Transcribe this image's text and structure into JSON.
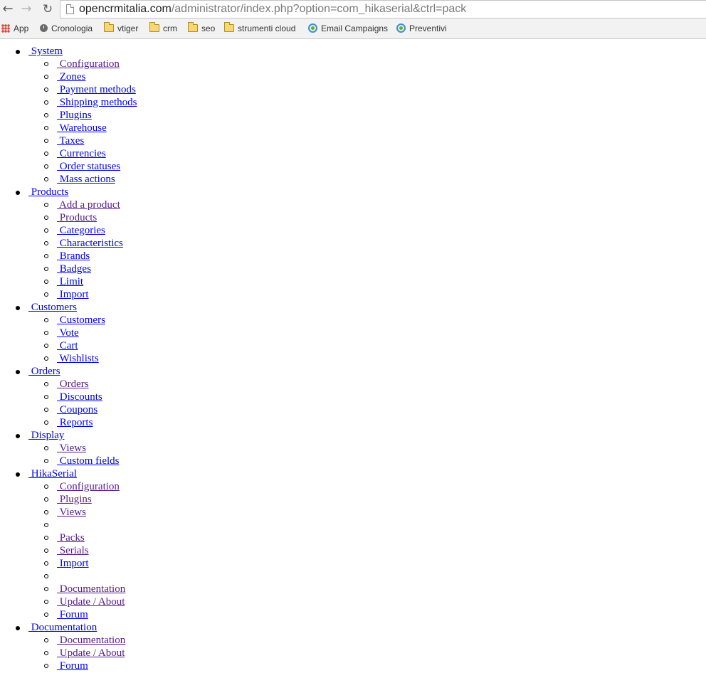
{
  "browser": {
    "url_host": "opencrmitalia.com",
    "url_path": "/administrator/index.php?option=com_hikaserial&ctrl=pack",
    "bookmarks": [
      {
        "label": "App",
        "icon": "apps-grid-icon"
      },
      {
        "label": "Cronologia",
        "icon": "history-clock-icon"
      },
      {
        "label": "vtiger",
        "icon": "folder-icon"
      },
      {
        "label": "crm",
        "icon": "folder-icon"
      },
      {
        "label": "seo",
        "icon": "folder-icon"
      },
      {
        "label": "strumenti cloud",
        "icon": "folder-icon"
      },
      {
        "label": "Email Campaigns",
        "icon": "crm-logo-icon"
      },
      {
        "label": "Preventivi",
        "icon": "crm-logo-icon"
      }
    ]
  },
  "menu": [
    {
      "label": " System",
      "children": [
        {
          "label": " Configuration",
          "visited": true
        },
        {
          "label": " Zones"
        },
        {
          "label": " Payment methods"
        },
        {
          "label": " Shipping methods"
        },
        {
          "label": " Plugins"
        },
        {
          "label": " Warehouse"
        },
        {
          "label": " Taxes"
        },
        {
          "label": " Currencies"
        },
        {
          "label": " Order statuses"
        },
        {
          "label": " Mass actions"
        }
      ]
    },
    {
      "label": " Products",
      "children": [
        {
          "label": " Add a product",
          "visited": true
        },
        {
          "label": " Products",
          "visited": true
        },
        {
          "label": " Categories"
        },
        {
          "label": " Characteristics"
        },
        {
          "label": " Brands"
        },
        {
          "label": " Badges"
        },
        {
          "label": " Limit"
        },
        {
          "label": " Import"
        }
      ]
    },
    {
      "label": " Customers",
      "children": [
        {
          "label": " Customers"
        },
        {
          "label": " Vote"
        },
        {
          "label": " Cart"
        },
        {
          "label": " Wishlists"
        }
      ]
    },
    {
      "label": " Orders",
      "children": [
        {
          "label": " Orders",
          "visited": true
        },
        {
          "label": " Discounts"
        },
        {
          "label": " Coupons"
        },
        {
          "label": " Reports"
        }
      ]
    },
    {
      "label": " Display",
      "children": [
        {
          "label": " Views",
          "visited": true
        },
        {
          "label": " Custom fields"
        }
      ]
    },
    {
      "label": " HikaSerial",
      "children": [
        {
          "label": " Configuration",
          "visited": true
        },
        {
          "label": " Plugins",
          "visited": true
        },
        {
          "label": " Views",
          "visited": true
        },
        {
          "label": ""
        },
        {
          "label": " Packs",
          "visited": true
        },
        {
          "label": " Serials",
          "visited": true
        },
        {
          "label": " Import"
        },
        {
          "label": ""
        },
        {
          "label": " Documentation",
          "visited": true
        },
        {
          "label": " Update / About",
          "visited": true
        },
        {
          "label": " Forum"
        }
      ]
    },
    {
      "label": " Documentation",
      "children": [
        {
          "label": " Documentation",
          "visited": true
        },
        {
          "label": " Update / About",
          "visited": true
        },
        {
          "label": " Forum"
        }
      ]
    }
  ]
}
